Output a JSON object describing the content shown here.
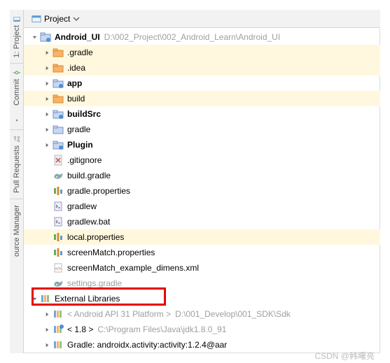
{
  "panel": {
    "view_mode": "Project"
  },
  "sidebar": {
    "tabs": [
      {
        "label": "1: Project"
      },
      {
        "label": "Commit"
      },
      {
        "label": "Pull Requests"
      },
      {
        "label": "ource Manager"
      }
    ]
  },
  "tree": [
    {
      "indent": 0,
      "chevron": "down",
      "icon": "module",
      "label": "Android_UI",
      "bold": true,
      "path": "D:\\002_Project\\002_Android_Learn\\Android_UI"
    },
    {
      "indent": 1,
      "chevron": "right",
      "icon": "folder-orange",
      "label": ".gradle",
      "hl": true
    },
    {
      "indent": 1,
      "chevron": "right",
      "icon": "folder-orange",
      "label": ".idea",
      "hl": true
    },
    {
      "indent": 1,
      "chevron": "right",
      "icon": "folder-module",
      "label": "app",
      "bold": true
    },
    {
      "indent": 1,
      "chevron": "right",
      "icon": "folder-orange",
      "label": "build",
      "hl": true
    },
    {
      "indent": 1,
      "chevron": "right",
      "icon": "folder-module",
      "label": "buildSrc",
      "bold": true
    },
    {
      "indent": 1,
      "chevron": "right",
      "icon": "folder",
      "label": "gradle"
    },
    {
      "indent": 1,
      "chevron": "right",
      "icon": "folder-module",
      "label": "Plugin",
      "bold": true
    },
    {
      "indent": 1,
      "chevron": "none",
      "icon": "gitignore",
      "label": ".gitignore"
    },
    {
      "indent": 1,
      "chevron": "none",
      "icon": "gradle-file",
      "label": "build.gradle"
    },
    {
      "indent": 1,
      "chevron": "none",
      "icon": "properties",
      "label": "gradle.properties"
    },
    {
      "indent": 1,
      "chevron": "none",
      "icon": "script",
      "label": "gradlew"
    },
    {
      "indent": 1,
      "chevron": "none",
      "icon": "script",
      "label": "gradlew.bat"
    },
    {
      "indent": 1,
      "chevron": "none",
      "icon": "properties",
      "label": "local.properties",
      "hl": true
    },
    {
      "indent": 1,
      "chevron": "none",
      "icon": "properties",
      "label": "screenMatch.properties"
    },
    {
      "indent": 1,
      "chevron": "none",
      "icon": "xml",
      "label": "screenMatch_example_dimens.xml"
    },
    {
      "indent": 1,
      "chevron": "none",
      "icon": "gradle-file",
      "label": "settings.gradle",
      "dim": true
    },
    {
      "indent": 0,
      "chevron": "down",
      "icon": "library",
      "label": "External Libraries"
    },
    {
      "indent": 1,
      "chevron": "right",
      "icon": "library",
      "label": "< Android API 31 Platform >",
      "path": "D:\\001_Develop\\001_SDK\\Sdk",
      "dim_clip": true
    },
    {
      "indent": 1,
      "chevron": "right",
      "icon": "library-jdk",
      "label": "< 1.8 >",
      "path": "C:\\Program Files\\Java\\jdk1.8.0_91"
    },
    {
      "indent": 1,
      "chevron": "right",
      "icon": "library-gradle",
      "label": "Gradle: androidx.activity:activity:1.2.4@aar"
    }
  ],
  "watermark": "CSDN @韩曙亮"
}
